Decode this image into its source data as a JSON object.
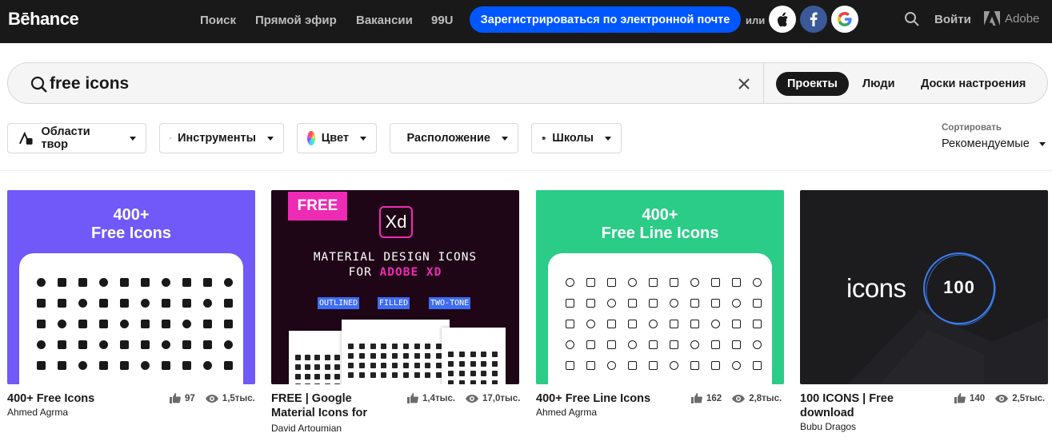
{
  "header": {
    "logo": "Bēhance",
    "nav": [
      "Поиск",
      "Прямой эфир",
      "Вакансии",
      "99U"
    ],
    "signup_label": "Зарегистрироваться по электронной почте",
    "or_label": "или",
    "login_label": "Войти",
    "adobe_label": "Adobe"
  },
  "search": {
    "value": "free icons",
    "tabs": [
      "Проекты",
      "Люди",
      "Доски настроения"
    ],
    "active_tab": "Проекты"
  },
  "filters": [
    "Области твор",
    "Инструменты",
    "Цвет",
    "Расположение",
    "Школы"
  ],
  "sort": {
    "label": "Сортировать",
    "value": "Рекомендуемые"
  },
  "projects": [
    {
      "title": "400+ Free Icons",
      "owner": "Ahmed Agrma",
      "likes": "97",
      "views": "1,5тыс.",
      "cover_text": [
        "400+",
        "Free Icons"
      ]
    },
    {
      "title": "FREE | Google Material Icons for",
      "owner": "David Artoumian",
      "likes": "1,4тыс.",
      "views": "17,0тыс.",
      "cover_tag": "FREE",
      "cover_logo": "Xd",
      "cover_line1": "MATERIAL DESIGN ICONS",
      "cover_line2_prefix": "FOR ",
      "cover_line2_accent": "ADOBE XD",
      "cover_chips": [
        "OUTLINED",
        "FILLED",
        "TWO-TONE"
      ]
    },
    {
      "title": "400+ Free Line Icons",
      "owner": "Ahmed Agrma",
      "likes": "162",
      "views": "2,8тыс.",
      "cover_text": [
        "400+",
        "Free Line Icons"
      ]
    },
    {
      "title": "100 ICONS | Free download",
      "owner": "Bubu Dragos",
      "likes": "140",
      "views": "2,5тыс.",
      "cover_word": "icons",
      "cover_number": "100"
    }
  ],
  "colors": {
    "topbar": "#191919",
    "signup": "#0057ff",
    "card1": "#7059f8",
    "card2": "#1f0617",
    "card3": "#2bcc87",
    "card4": "#1c1c1e",
    "xd_pink": "#ee2bb5"
  }
}
